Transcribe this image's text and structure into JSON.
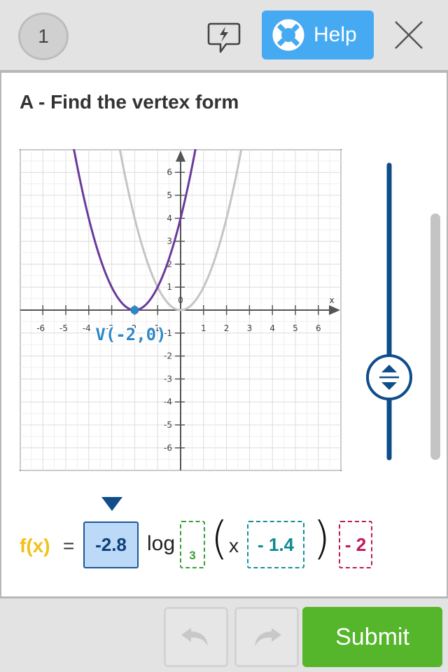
{
  "header": {
    "step_number": "1",
    "help_label": "Help",
    "hint_icon": "lightning-speech-bubble-icon",
    "help_icon": "lifebuoy-icon",
    "close_icon": "close-icon"
  },
  "question": {
    "title": "A - Find the vertex form"
  },
  "graph": {
    "x_axis_label": "x",
    "x_ticks": [
      "-6",
      "-5",
      "-4",
      "-3",
      "-2",
      "-1",
      "0",
      "1",
      "2",
      "3",
      "4",
      "5",
      "6"
    ],
    "y_ticks": [
      "-6",
      "-5",
      "-4",
      "-3",
      "-2",
      "-1",
      "1",
      "2",
      "3",
      "4",
      "5",
      "6"
    ],
    "vertex_label": "V(-2,0)",
    "vertex": {
      "x": -2,
      "y": 0
    },
    "reference_curve": {
      "a": 1,
      "h": 0,
      "k": 0,
      "color": "#c4c4c4"
    },
    "active_curve": {
      "a": 1,
      "h": -2,
      "k": 0,
      "color": "#6a3a9c"
    }
  },
  "formula": {
    "fx_label": "f(x)",
    "equals": "=",
    "a_value": "-2.8",
    "log_label": "log",
    "base_value": "3",
    "open_paren": "(",
    "x_label": "x",
    "h_value": "- 1.4",
    "close_paren": ")",
    "k_value": "- 2"
  },
  "footer": {
    "submit_label": "Submit",
    "undo_icon": "undo-icon",
    "redo_icon": "redo-icon"
  },
  "colors": {
    "accent_blue": "#45aaf2",
    "slider_blue": "#0f4c8a",
    "fx_yellow": "#f2c11a",
    "base_green": "#38a036",
    "h_teal": "#119298",
    "k_magenta": "#c0195b",
    "submit_green": "#55b52b"
  }
}
